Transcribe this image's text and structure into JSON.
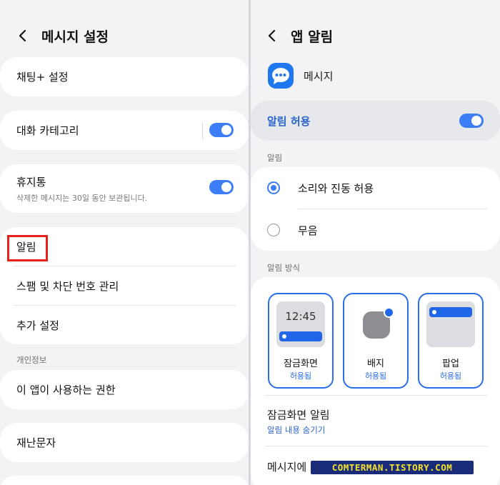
{
  "left": {
    "title": "메시지 설정",
    "chat_plus": "채팅+ 설정",
    "conversation_categories": "대화 카테고리",
    "trash": "휴지통",
    "trash_desc": "삭제한 메시지는 30일 동안 보관됩니다.",
    "notifications": "알림",
    "spam": "스팸 및 차단 번호 관리",
    "more_settings": "추가 설정",
    "privacy_header": "개인정보",
    "app_permissions": "이 앱이 사용하는 권한",
    "emergency": "재난문자",
    "conversation_categories_on": true,
    "trash_on": true
  },
  "right": {
    "title": "앱 알림",
    "app_name": "메시지",
    "allow_notifications": "알림 허용",
    "allow_notifications_on": true,
    "alerts_header": "알림",
    "sound_vibrate": "소리와 진동 허용",
    "silent": "무음",
    "selected_alert": "소리와 진동 허용",
    "style_header": "알림 방식",
    "tiles": [
      {
        "name": "잠금화면",
        "state": "허용됨",
        "preview_time": "12:45"
      },
      {
        "name": "배지",
        "state": "허용됨"
      },
      {
        "name": "팝업",
        "state": "허용됨"
      }
    ],
    "lock_screen_notifications": "잠금화면 알림",
    "lock_screen_value": "알림 내용 숨기기",
    "messages_in": "메시지에"
  },
  "watermark": "COMTERMAN.TISTORY.COM",
  "colors": {
    "accent": "#3d7df5",
    "highlight": "#e8201a",
    "watermark_bg": "#1a2b7a",
    "watermark_fg": "#f2e32a"
  }
}
